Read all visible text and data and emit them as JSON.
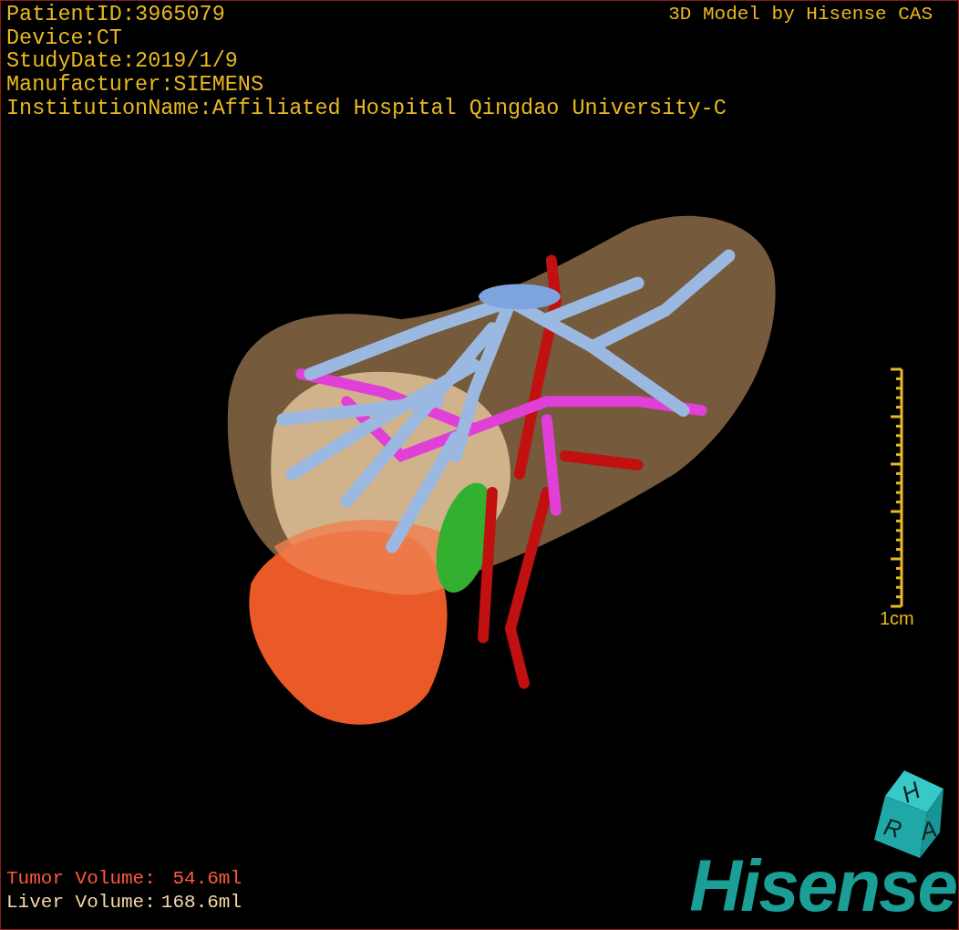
{
  "info_lines": [
    "PatientID:3965079",
    "Device:CT",
    "StudyDate:2019/1/9",
    "Manufacturer:SIEMENS",
    "InstitutionName:Affiliated Hospital Qingdao University-C"
  ],
  "title": "3D Model by Hisense CAS",
  "scale_bar": {
    "label": "1cm"
  },
  "volumes": [
    {
      "label": "Tumor Volume:",
      "value": "54.6ml",
      "color": "#ff5a3c"
    },
    {
      "label": "Liver Volume:",
      "value": "168.6ml",
      "color": "#f5d7a8"
    }
  ],
  "orientation_cube": {
    "faces": [
      "H",
      "R",
      "A"
    ]
  },
  "logo": "Hisense"
}
